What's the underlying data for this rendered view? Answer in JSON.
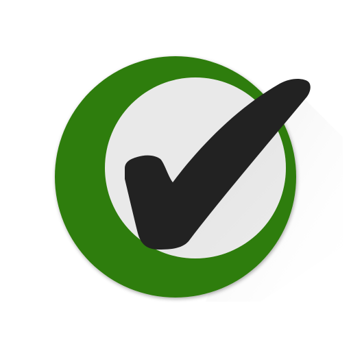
{
  "icon": {
    "name": "checkmark-icon",
    "colors": {
      "background": "#ffffff",
      "ring": "#2e7d0a",
      "inner_disc": "#e9e9e9",
      "check": "#222222",
      "long_shadow": "#d9d9d9"
    }
  }
}
